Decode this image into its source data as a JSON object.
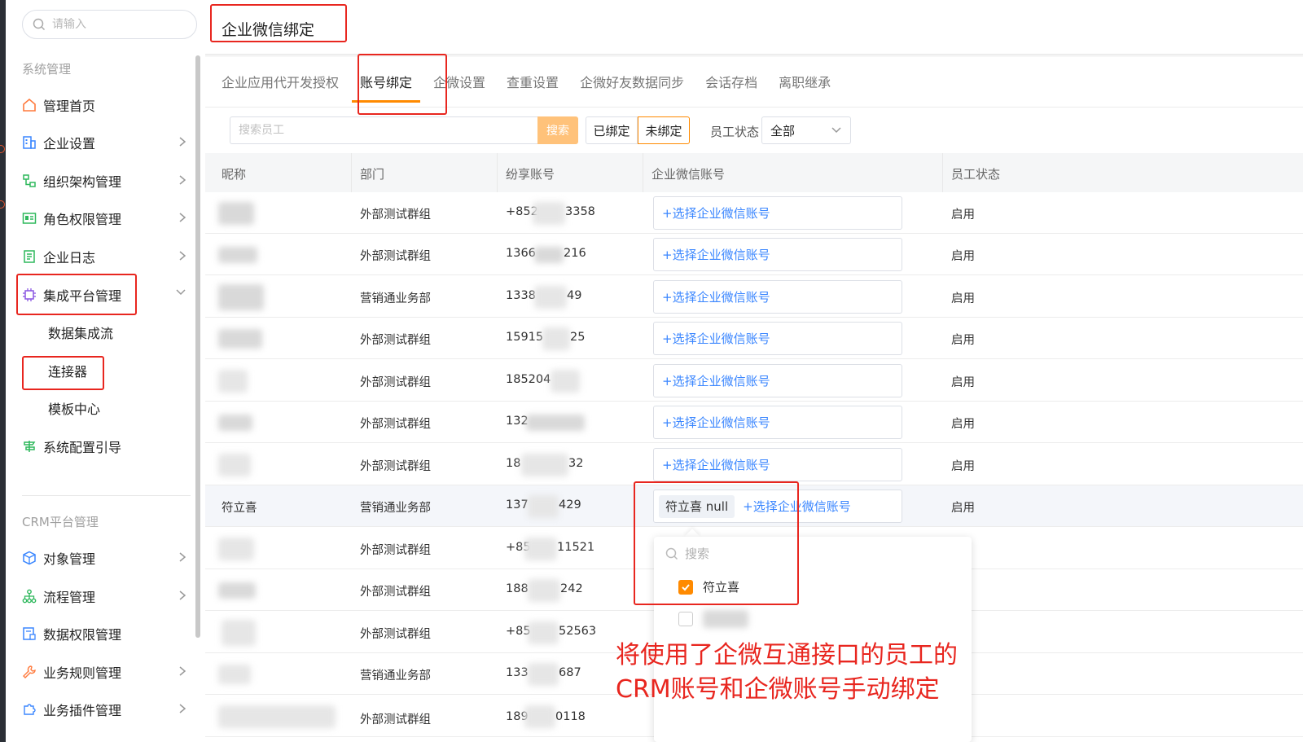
{
  "sidebar": {
    "search_placeholder": "请输入",
    "group_system": "系统管理",
    "group_crm": "CRM平台管理",
    "items": [
      {
        "label": "管理首页"
      },
      {
        "label": "企业设置"
      },
      {
        "label": "组织架构管理"
      },
      {
        "label": "角色权限管理"
      },
      {
        "label": "企业日志"
      },
      {
        "label": "集成平台管理"
      },
      {
        "label": "系统配置引导"
      },
      {
        "label": "对象管理"
      },
      {
        "label": "流程管理"
      },
      {
        "label": "数据权限管理"
      },
      {
        "label": "业务规则管理"
      },
      {
        "label": "业务插件管理"
      }
    ],
    "subitems": [
      {
        "label": "数据集成流"
      },
      {
        "label": "连接器"
      },
      {
        "label": "模板中心"
      }
    ]
  },
  "header": {
    "title": "企业微信绑定"
  },
  "tabs": [
    {
      "label": "企业应用代开发授权"
    },
    {
      "label": "账号绑定"
    },
    {
      "label": "企微设置"
    },
    {
      "label": "查重设置"
    },
    {
      "label": "企微好友数据同步"
    },
    {
      "label": "会话存档"
    },
    {
      "label": "离职继承"
    }
  ],
  "filter": {
    "search_placeholder": "搜索员工",
    "search_button": "搜索",
    "bound": "已绑定",
    "unbound": "未绑定",
    "status_label": "员工状态",
    "status_value": "全部"
  },
  "table": {
    "columns": [
      "昵称",
      "部门",
      "纷享账号",
      "企业微信账号",
      "员工状态"
    ],
    "select_label": "+选择企业微信账号",
    "rows": [
      {
        "nickname": "",
        "dept": "外部测试群组",
        "acct_a": "+852",
        "acct_b": "3358",
        "status": "启用"
      },
      {
        "nickname": "",
        "dept": "外部测试群组",
        "acct_a": "1366",
        "acct_b": "216",
        "status": "启用"
      },
      {
        "nickname": "",
        "dept": "营销通业务部",
        "acct_a": "1338",
        "acct_b": "49",
        "status": "启用"
      },
      {
        "nickname": "",
        "dept": "外部测试群组",
        "acct_a": "15915",
        "acct_b": "25",
        "status": "启用"
      },
      {
        "nickname": "",
        "dept": "外部测试群组",
        "acct_a": "185204",
        "acct_b": "",
        "status": "启用"
      },
      {
        "nickname": "",
        "dept": "外部测试群组",
        "acct_a": "132",
        "acct_b": "",
        "status": "启用"
      },
      {
        "nickname": "",
        "dept": "外部测试群组",
        "acct_a": "18",
        "acct_b": "32",
        "status": "启用"
      },
      {
        "nickname": "符立喜",
        "dept": "营销通业务部",
        "acct_a": "137",
        "acct_b": "429",
        "status": "启用",
        "tag": "符立喜 null"
      },
      {
        "nickname": "",
        "dept": "外部测试群组",
        "acct_a": "+85",
        "acct_b": "11521",
        "status": ""
      },
      {
        "nickname": "",
        "dept": "外部测试群组",
        "acct_a": "188",
        "acct_b": "242",
        "status": ""
      },
      {
        "nickname": "",
        "dept": "外部测试群组",
        "acct_a": "+85",
        "acct_b": "52563",
        "status": ""
      },
      {
        "nickname": "",
        "dept": "营销通业务部",
        "acct_a": "133",
        "acct_b": "687",
        "status": ""
      },
      {
        "nickname": "",
        "dept": "外部测试群组",
        "acct_a": "189",
        "acct_b": "0118",
        "status": ""
      }
    ]
  },
  "dropdown": {
    "search_placeholder": "搜索",
    "options": [
      {
        "label": "符立喜",
        "checked": true
      },
      {
        "label": "",
        "checked": false
      }
    ]
  },
  "annotation": {
    "line1": "将使用了企微互通接口的员工的",
    "line2": "CRM账号和企微账号手动绑定"
  },
  "colors": {
    "accent": "#ff8a00",
    "link": "#3a86ff",
    "highlight": "#e8261f"
  }
}
